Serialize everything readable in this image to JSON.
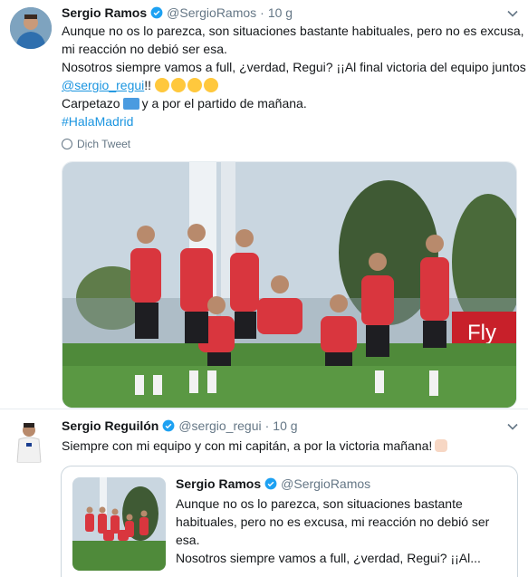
{
  "tweet1": {
    "author_name": "Sergio Ramos",
    "handle": "@SergioRamos",
    "separator": "·",
    "time": "10 g",
    "lines": [
      "Aunque no os lo parezca, son situaciones bastante habituales, pero no es excusa,",
      "mi reacción no debió ser esa.",
      "Nosotros siempre vamos a full, ¿verdad, Regui? ¡¡Al final victoria del equipo juntos"
    ],
    "mention": "@sergio_regui",
    "after_mention": "!!",
    "carpetazo_before": "Carpetazo",
    "carpetazo_after": "y a por el partido de mañana.",
    "hashtag": "#HalaMadrid",
    "translate_label": "Dịch Tweet",
    "photo_banner_text": "Fly"
  },
  "tweet2": {
    "author_name": "Sergio Reguilón",
    "handle": "@sergio_regui",
    "separator": "·",
    "time": "10 g",
    "text": "Siempre con mi equipo y con mi capitán, a por la victoria mañana!"
  },
  "quoted": {
    "author_name": "Sergio Ramos",
    "handle": "@SergioRamos",
    "lines": [
      "Aunque no os lo parezca, son situaciones bastante",
      "habituales, pero no es excusa, mi reacción no debió ser",
      "esa.",
      "Nosotros siempre vamos a full, ¿verdad, Regui? ¡¡Al..."
    ]
  },
  "colors": {
    "link": "#1b95e0",
    "verified": "#1da1f2",
    "muted": "#657786",
    "kit_red": "#d9363e"
  },
  "icons": [
    "verified-badge-icon",
    "chevron-down-icon",
    "globe-icon",
    "folder-emoji",
    "laughing-emoji",
    "flexed-biceps-emoji"
  ]
}
